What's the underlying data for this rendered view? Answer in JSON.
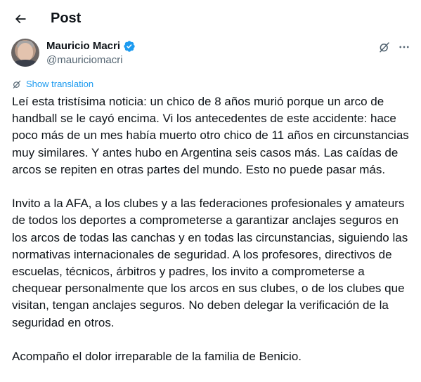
{
  "header": {
    "title": "Post"
  },
  "author": {
    "name": "Mauricio Macri",
    "handle": "@mauriciomacri",
    "verified": true
  },
  "translate": {
    "label": "Show translation"
  },
  "post": {
    "paragraphs": [
      "Leí esta tristísima noticia: un chico de 8 años murió porque un arco de handball se le cayó encima. Vi los antecedentes de este accidente: hace poco más de un mes había muerto otro chico de 11 años en circunstancias muy similares. Y antes hubo en Argentina seis casos más. Las caídas de arcos se repiten en otras partes del mundo. Esto no puede pasar más.",
      "Invito a la AFA, a los clubes y a las federaciones profesionales y amateurs de todos los deportes a comprometerse a garantizar anclajes seguros en los arcos de todas las canchas y en todas las circunstancias, siguiendo las normativas internacionales de seguridad. A los profesores, directivos de escuelas, técnicos, árbitros y padres, los invito a comprometerse a chequear personalmente que los arcos en sus clubes, o de los clubes que visitan, tengan anclajes seguros. No deben delegar la verificación de la seguridad en otros.",
      "Acompaño el dolor irreparable de la familia de Benicio."
    ]
  },
  "colors": {
    "text": "#0f1419",
    "secondary": "#536471",
    "accent": "#1d9bf0"
  },
  "icons": {
    "back": "arrow-left-icon",
    "verified": "verified-badge-icon",
    "grok": "grok-icon",
    "more": "more-horizontal-icon",
    "translate": "translate-icon"
  }
}
